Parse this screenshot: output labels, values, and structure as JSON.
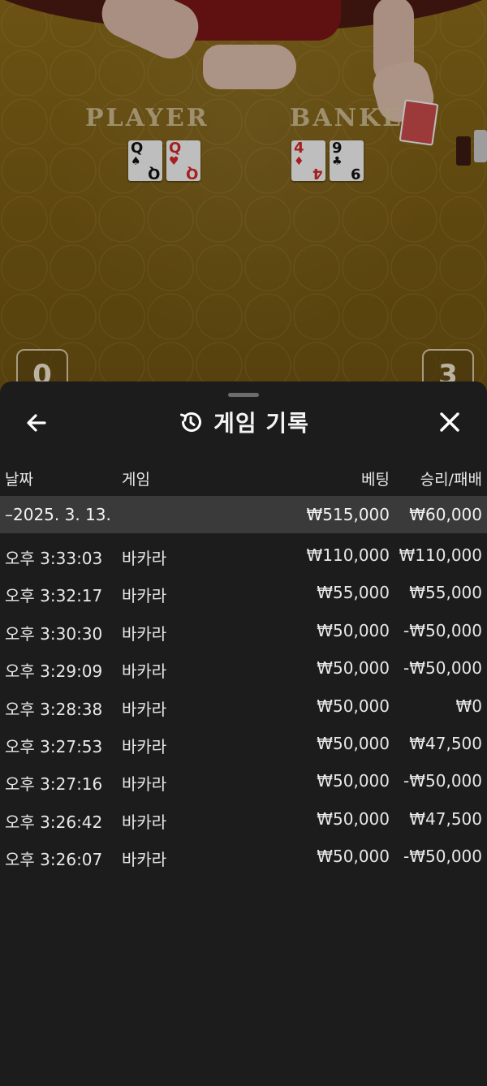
{
  "table": {
    "player_label": "PLAYER",
    "banker_label": "BANKE",
    "player_cards": [
      {
        "rank": "Q",
        "suit": "♠",
        "color": "black"
      },
      {
        "rank": "Q",
        "suit": "♥",
        "color": "red"
      }
    ],
    "banker_cards": [
      {
        "rank": "4",
        "suit": "♦",
        "color": "red"
      },
      {
        "rank": "9",
        "suit": "♣",
        "color": "black"
      }
    ],
    "player_score": "0",
    "banker_score": "3"
  },
  "sheet": {
    "title": "게임 기록",
    "columns": {
      "date": "날짜",
      "game": "게임",
      "bet": "베팅",
      "result": "승리/패배"
    },
    "day_group": {
      "date": "–2025. 3. 13.",
      "bet_total": "₩515,000",
      "result_total": "₩60,000"
    },
    "rows": [
      {
        "time": "오후 3:33:03",
        "game": "바카라",
        "bet": "₩110,000",
        "result": "₩110,000"
      },
      {
        "time": "오후 3:32:17",
        "game": "바카라",
        "bet": "₩55,000",
        "result": "₩55,000"
      },
      {
        "time": "오후 3:30:30",
        "game": "바카라",
        "bet": "₩50,000",
        "result": "-₩50,000"
      },
      {
        "time": "오후 3:29:09",
        "game": "바카라",
        "bet": "₩50,000",
        "result": "-₩50,000"
      },
      {
        "time": "오후 3:28:38",
        "game": "바카라",
        "bet": "₩50,000",
        "result": "₩0"
      },
      {
        "time": "오후 3:27:53",
        "game": "바카라",
        "bet": "₩50,000",
        "result": "₩47,500"
      },
      {
        "time": "오후 3:27:16",
        "game": "바카라",
        "bet": "₩50,000",
        "result": "-₩50,000"
      },
      {
        "time": "오후 3:26:42",
        "game": "바카라",
        "bet": "₩50,000",
        "result": "₩47,500"
      },
      {
        "time": "오후 3:26:07",
        "game": "바카라",
        "bet": "₩50,000",
        "result": "-₩50,000"
      }
    ]
  },
  "icons": {
    "back": "arrow-left-icon",
    "history": "history-icon",
    "close": "close-icon"
  },
  "colors": {
    "sheet_bg": "#1c1c1c",
    "day_row_bg": "#3a3a3a",
    "table_felt": "#7d5f15"
  }
}
